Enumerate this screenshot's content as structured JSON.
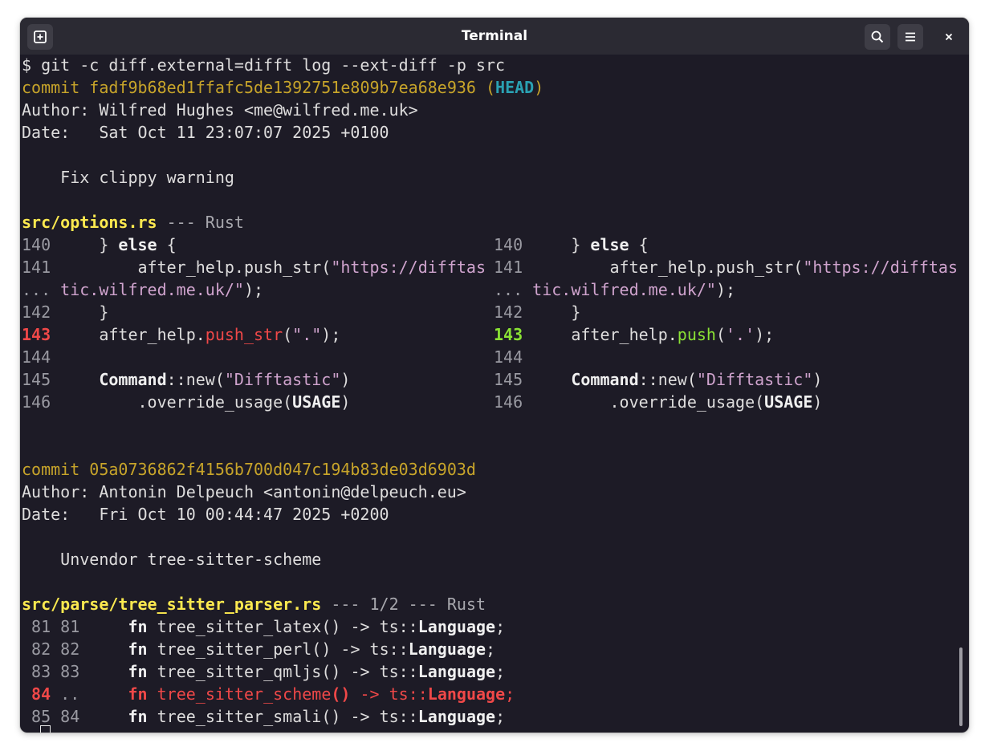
{
  "window": {
    "title": "Terminal"
  },
  "icons": {
    "new_tab": "new-tab-icon",
    "search": "search-icon",
    "menu": "hamburger-menu-icon",
    "close": "close-icon"
  },
  "colors": {
    "background": "#1d1b26",
    "titlebar": "#2b2a33",
    "commit_hash": "#c7a42a",
    "head_ref": "#2aa1b3",
    "file_header": "#fce94f",
    "removed": "#f04848",
    "added": "#8ae234",
    "string": "#cfa3cd"
  },
  "terminal": {
    "prompt": "$ git -c diff.external=difft log --ext-diff -p src",
    "commit1": {
      "label": "commit",
      "hash": "fadf9b68ed1ffafc5de1392751e809b7ea68e936",
      "ref_open": "(",
      "ref": "HEAD",
      "ref_close": ")",
      "author": "Author: Wilfred Hughes <me@wilfred.me.uk>",
      "date": "Date:   Sat Oct 11 23:07:07 2025 +0100",
      "message": "    Fix clippy warning",
      "file": "src/options.rs",
      "file_suffix": " --- Rust",
      "diff_rows": [
        {
          "ln": "140",
          "code_a": "    } ",
          "kw": "else",
          "code_b": " {"
        },
        {
          "ln": "141",
          "code_a": "        after_help.push_str(",
          "str": "\"https://difftas"
        },
        {
          "ln": "...",
          "str": "tic.wilfred.me.uk/\"",
          "code_b": ");"
        },
        {
          "ln": "142",
          "code_a": "    }"
        },
        {
          "ln": "143",
          "code_a": "    after_help.",
          "old_fn": "push_str",
          "old_open": "(",
          "old_str": "\".\"",
          "new_fn": "push",
          "new_open": "(",
          "new_str": "'.'",
          "code_b": ");"
        },
        {
          "ln": "144"
        },
        {
          "ln": "145",
          "code_a": "    ",
          "kw": "Command",
          "code_b": "::new(",
          "str": "\"Difftastic\"",
          "code_c": ")"
        },
        {
          "ln": "146",
          "code_a": "        .override_usage(",
          "kw": "USAGE",
          "code_b": ")"
        }
      ]
    },
    "commit2": {
      "label": "commit",
      "hash": "05a0736862f4156b700d047c194b83de03d6903d",
      "author": "Author: Antonin Delpeuch <antonin@delpeuch.eu>",
      "date": "Date:   Fri Oct 10 00:44:47 2025 +0200",
      "message": "    Unvendor tree-sitter-scheme",
      "file": "src/parse/tree_sitter_parser.rs",
      "file_suffix": " --- 1/2 --- Rust",
      "rows": [
        {
          "ln_old": " 81",
          "ln_new": "81",
          "indent": "     ",
          "kw": "fn",
          "name": " tree_sitter_latex() -> ts::",
          "type": "Language",
          "end": ";"
        },
        {
          "ln_old": " 82",
          "ln_new": "82",
          "indent": "     ",
          "kw": "fn",
          "name": " tree_sitter_perl() -> ts::",
          "type": "Language",
          "end": ";"
        },
        {
          "ln_old": " 83",
          "ln_new": "83",
          "indent": "     ",
          "kw": "fn",
          "name": " tree_sitter_qmljs() -> ts::",
          "type": "Language",
          "end": ";"
        },
        {
          "ln_old": " 84",
          "ln_new": "..",
          "indent": "     ",
          "kw": "fn",
          "name": " tree_sitter_scheme",
          "parens": "()",
          "arrow": " -> ts::",
          "type": "Language",
          "end": ";"
        },
        {
          "ln_old": " 85",
          "ln_new": "84",
          "indent": "     ",
          "kw": "fn",
          "name": " tree_sitter_smali() -> ts::",
          "type": "Language",
          "end": ";"
        }
      ]
    }
  }
}
